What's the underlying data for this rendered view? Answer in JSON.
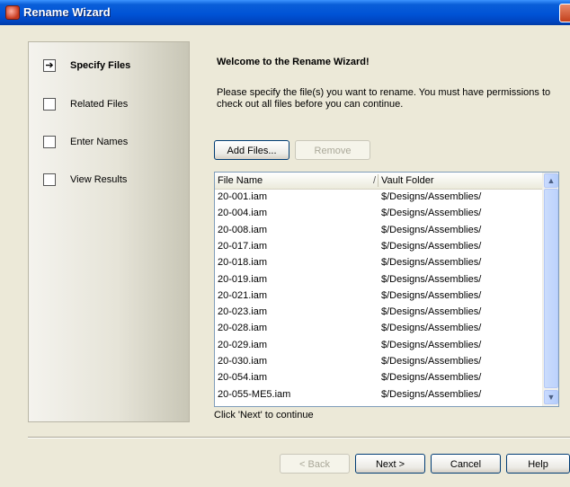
{
  "window": {
    "title": "Rename Wizard"
  },
  "steps": [
    {
      "label": "Specify Files",
      "active": true,
      "mark": "➔"
    },
    {
      "label": "Related Files",
      "active": false,
      "mark": ""
    },
    {
      "label": "Enter Names",
      "active": false,
      "mark": ""
    },
    {
      "label": "View Results",
      "active": false,
      "mark": ""
    }
  ],
  "content": {
    "heading": "Welcome to the Rename Wizard!",
    "instructions": "Please specify the file(s) you want to rename.  You must have permissions to check out all files before you can continue.",
    "add_files_label": "Add Files...",
    "remove_label": "Remove",
    "hint": "Click 'Next' to continue"
  },
  "table": {
    "columns": [
      "File Name",
      "Vault Folder"
    ],
    "sort_indicator": "/",
    "rows": [
      {
        "file": "20-001.iam",
        "folder": "$/Designs/Assemblies/"
      },
      {
        "file": "20-004.iam",
        "folder": "$/Designs/Assemblies/"
      },
      {
        "file": "20-008.iam",
        "folder": "$/Designs/Assemblies/"
      },
      {
        "file": "20-017.iam",
        "folder": "$/Designs/Assemblies/"
      },
      {
        "file": "20-018.iam",
        "folder": "$/Designs/Assemblies/"
      },
      {
        "file": "20-019.iam",
        "folder": "$/Designs/Assemblies/"
      },
      {
        "file": "20-021.iam",
        "folder": "$/Designs/Assemblies/"
      },
      {
        "file": "20-023.iam",
        "folder": "$/Designs/Assemblies/"
      },
      {
        "file": "20-028.iam",
        "folder": "$/Designs/Assemblies/"
      },
      {
        "file": "20-029.iam",
        "folder": "$/Designs/Assemblies/"
      },
      {
        "file": "20-030.iam",
        "folder": "$/Designs/Assemblies/"
      },
      {
        "file": "20-054.iam",
        "folder": "$/Designs/Assemblies/"
      },
      {
        "file": "20-055-ME5.iam",
        "folder": "$/Designs/Assemblies/"
      }
    ]
  },
  "buttons": {
    "back": "< Back",
    "next": "Next >",
    "cancel": "Cancel",
    "help": "Help"
  },
  "icons": {
    "title": "wizard-app-icon",
    "step_arrow": "arrow-right-icon",
    "scroll_up": "scroll-up-arrow-icon",
    "scroll_down": "scroll-down-arrow-icon"
  },
  "colors": {
    "titlebar": "#0053d6",
    "dialog": "#ece9d8",
    "list_border": "#7f9db9",
    "button_border": "#003c74"
  }
}
